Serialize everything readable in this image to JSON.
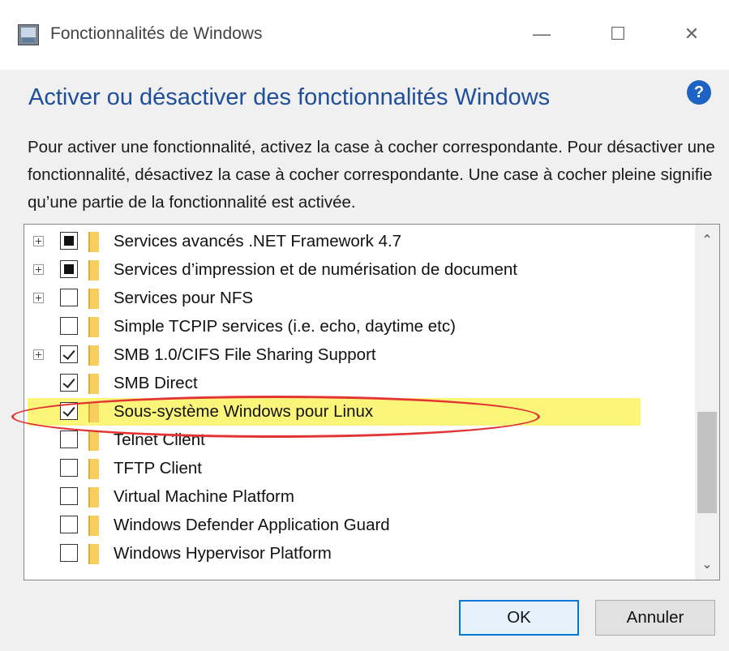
{
  "window": {
    "title": "Fonctionnalités de Windows",
    "controls": {
      "minimize": "—",
      "maximize": "☐",
      "close": "✕"
    }
  },
  "heading": "Activer ou désactiver des fonctionnalités Windows",
  "help": {
    "label": "?"
  },
  "description": "Pour activer une fonctionnalité, activez la case à cocher correspondante. Pour désactiver une fonctionnalité, désactivez la case à cocher correspondante. Une case à cocher pleine signifie qu’une partie de la fonctionnalité est activée.",
  "features": [
    {
      "label": "Services avancés .NET Framework 4.7",
      "state": "partial",
      "expandable": true
    },
    {
      "label": "Services d’impression et de numérisation de document",
      "state": "partial",
      "expandable": true
    },
    {
      "label": "Services pour NFS",
      "state": "unchecked",
      "expandable": true
    },
    {
      "label": "Simple TCPIP services (i.e. echo, daytime etc)",
      "state": "unchecked",
      "expandable": false
    },
    {
      "label": "SMB 1.0/CIFS File Sharing Support",
      "state": "checked",
      "expandable": true
    },
    {
      "label": "SMB Direct",
      "state": "checked",
      "expandable": false
    },
    {
      "label": "Sous-système Windows pour Linux",
      "state": "checked",
      "expandable": false,
      "highlighted": true
    },
    {
      "label": "Telnet Client",
      "state": "unchecked",
      "expandable": false
    },
    {
      "label": "TFTP Client",
      "state": "unchecked",
      "expandable": false
    },
    {
      "label": "Virtual Machine Platform",
      "state": "unchecked",
      "expandable": false
    },
    {
      "label": "Windows Defender Application Guard",
      "state": "unchecked",
      "expandable": false
    },
    {
      "label": "Windows Hypervisor Platform",
      "state": "unchecked",
      "expandable": false
    }
  ],
  "scrollbar": {
    "up": "⌃",
    "down": "⌄"
  },
  "buttons": {
    "ok": "OK",
    "cancel": "Annuler"
  },
  "colors": {
    "heading": "#1f4e9a",
    "highlight": "#fbf67a",
    "annotation": "#e23434",
    "primary_border": "#0078d7"
  }
}
